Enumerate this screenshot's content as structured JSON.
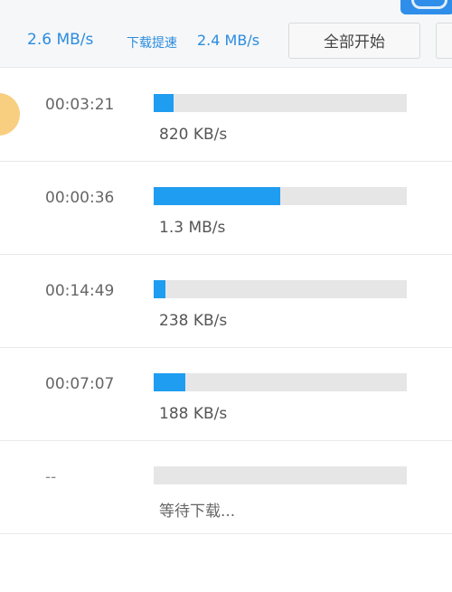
{
  "toolbar": {
    "total_speed": "2.6 MB/s",
    "download_label": "下载提速",
    "download_speed": "2.4 MB/s",
    "start_all_label": "全部开始"
  },
  "downloads": [
    {
      "remaining_time": "00:03:21",
      "progress": 0.08,
      "speed": "820 KB/s"
    },
    {
      "remaining_time": "00:00:36",
      "progress": 0.5,
      "speed": "1.3 MB/s"
    },
    {
      "remaining_time": "00:14:49",
      "progress": 0.045,
      "speed": "238 KB/s"
    },
    {
      "remaining_time": "00:07:07",
      "progress": 0.125,
      "speed": "188 KB/s"
    },
    {
      "remaining_time": "--",
      "progress": 0,
      "speed": "等待下载..."
    }
  ],
  "colors": {
    "accent": "#1f9df0",
    "toolbar_text": "#2b8cdf",
    "track": "#e6e6e7",
    "avatar": "#f8cf80"
  }
}
